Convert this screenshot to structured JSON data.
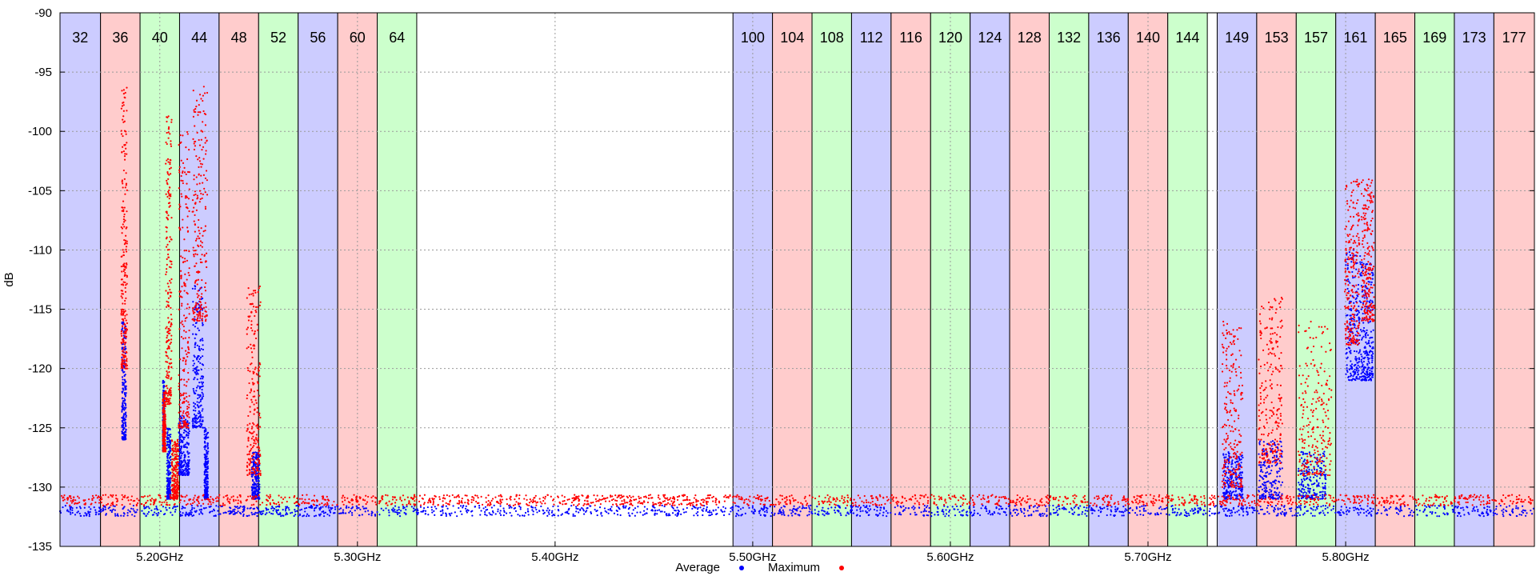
{
  "chart_data": {
    "type": "scatter",
    "xlabel": "",
    "ylabel": "dB",
    "xlim": [
      5.1495,
      5.8955
    ],
    "ylim": [
      -135,
      -90
    ],
    "grid": true,
    "x_ticks": [
      {
        "value": 5.2,
        "label": "5.20GHz"
      },
      {
        "value": 5.3,
        "label": "5.30GHz"
      },
      {
        "value": 5.4,
        "label": "5.40GHz"
      },
      {
        "value": 5.5,
        "label": "5.50GHz"
      },
      {
        "value": 5.6,
        "label": "5.60GHz"
      },
      {
        "value": 5.7,
        "label": "5.70GHz"
      },
      {
        "value": 5.8,
        "label": "5.80GHz"
      }
    ],
    "y_ticks": [
      {
        "value": -90,
        "label": "-90"
      },
      {
        "value": -95,
        "label": "-95"
      },
      {
        "value": -100,
        "label": "-100"
      },
      {
        "value": -105,
        "label": "-105"
      },
      {
        "value": -110,
        "label": "-110"
      },
      {
        "value": -115,
        "label": "-115"
      },
      {
        "value": -120,
        "label": "-120"
      },
      {
        "value": -125,
        "label": "-125"
      },
      {
        "value": -130,
        "label": "-130"
      },
      {
        "value": -135,
        "label": "-135"
      }
    ],
    "channel_colors": {
      "blue": "#ccccff",
      "red": "#ffcccc",
      "green": "#ccffcc"
    },
    "channels": [
      {
        "label": "32",
        "start": 5.1495,
        "end": 5.17,
        "color": "blue"
      },
      {
        "label": "36",
        "start": 5.17,
        "end": 5.19,
        "color": "red"
      },
      {
        "label": "40",
        "start": 5.19,
        "end": 5.21,
        "color": "green"
      },
      {
        "label": "44",
        "start": 5.21,
        "end": 5.23,
        "color": "blue"
      },
      {
        "label": "48",
        "start": 5.23,
        "end": 5.25,
        "color": "red"
      },
      {
        "label": "52",
        "start": 5.25,
        "end": 5.27,
        "color": "green"
      },
      {
        "label": "56",
        "start": 5.27,
        "end": 5.29,
        "color": "blue"
      },
      {
        "label": "60",
        "start": 5.29,
        "end": 5.31,
        "color": "red"
      },
      {
        "label": "64",
        "start": 5.31,
        "end": 5.33,
        "color": "green"
      },
      {
        "label": "100",
        "start": 5.49,
        "end": 5.51,
        "color": "blue"
      },
      {
        "label": "104",
        "start": 5.51,
        "end": 5.53,
        "color": "red"
      },
      {
        "label": "108",
        "start": 5.53,
        "end": 5.55,
        "color": "green"
      },
      {
        "label": "112",
        "start": 5.55,
        "end": 5.57,
        "color": "blue"
      },
      {
        "label": "116",
        "start": 5.57,
        "end": 5.59,
        "color": "red"
      },
      {
        "label": "120",
        "start": 5.59,
        "end": 5.61,
        "color": "green"
      },
      {
        "label": "124",
        "start": 5.61,
        "end": 5.63,
        "color": "blue"
      },
      {
        "label": "128",
        "start": 5.63,
        "end": 5.65,
        "color": "red"
      },
      {
        "label": "132",
        "start": 5.65,
        "end": 5.67,
        "color": "green"
      },
      {
        "label": "136",
        "start": 5.67,
        "end": 5.69,
        "color": "blue"
      },
      {
        "label": "140",
        "start": 5.69,
        "end": 5.71,
        "color": "red"
      },
      {
        "label": "144",
        "start": 5.71,
        "end": 5.73,
        "color": "green"
      },
      {
        "label": "149",
        "start": 5.735,
        "end": 5.755,
        "color": "blue"
      },
      {
        "label": "153",
        "start": 5.755,
        "end": 5.775,
        "color": "red"
      },
      {
        "label": "157",
        "start": 5.775,
        "end": 5.795,
        "color": "green"
      },
      {
        "label": "161",
        "start": 5.795,
        "end": 5.815,
        "color": "blue"
      },
      {
        "label": "165",
        "start": 5.815,
        "end": 5.835,
        "color": "red"
      },
      {
        "label": "169",
        "start": 5.835,
        "end": 5.855,
        "color": "green"
      },
      {
        "label": "173",
        "start": 5.855,
        "end": 5.875,
        "color": "blue"
      },
      {
        "label": "177",
        "start": 5.875,
        "end": 5.8955,
        "color": "red"
      }
    ],
    "series": [
      {
        "name": "Average",
        "color": "#0000ff",
        "floor_y": -132.0,
        "peaks": [
          {
            "x": [
              5.1808,
              5.183
            ],
            "y": [
              -126,
              -116
            ]
          },
          {
            "x": [
              5.2015,
              5.2025
            ],
            "y": [
              -127,
              -121
            ]
          },
          {
            "x": [
              5.2035,
              5.2055
            ],
            "y": [
              -131,
              -125
            ]
          },
          {
            "x": [
              5.2095,
              5.215
            ],
            "y": [
              -129,
              -124
            ]
          },
          {
            "x": [
              5.2165,
              5.222
            ],
            "y": [
              -125,
              -113
            ]
          },
          {
            "x": [
              5.2225,
              5.2245
            ],
            "y": [
              -131,
              -125
            ]
          },
          {
            "x": [
              5.2465,
              5.2505
            ],
            "y": [
              -131,
              -127
            ]
          },
          {
            "x": [
              5.738,
              5.748
            ],
            "y": [
              -131,
              -127
            ]
          },
          {
            "x": [
              5.756,
              5.768
            ],
            "y": [
              -131,
              -126
            ]
          },
          {
            "x": [
              5.776,
              5.79
            ],
            "y": [
              -131,
              -127
            ]
          },
          {
            "x": [
              5.8,
              5.808
            ],
            "y": [
              -121,
              -110
            ]
          },
          {
            "x": [
              5.808,
              5.814
            ],
            "y": [
              -121,
              -111
            ]
          }
        ]
      },
      {
        "name": "Maximum",
        "color": "#ff0000",
        "floor_y": -131.1,
        "peaks": [
          {
            "x": [
              5.1805,
              5.1835
            ],
            "y": [
              -120,
              -96
            ]
          },
          {
            "x": [
              5.2015,
              5.203
            ],
            "y": [
              -127,
              -122
            ]
          },
          {
            "x": [
              5.203,
              5.206
            ],
            "y": [
              -123,
              -98
            ]
          },
          {
            "x": [
              5.206,
              5.2095
            ],
            "y": [
              -131,
              -126
            ]
          },
          {
            "x": [
              5.2095,
              5.215
            ],
            "y": [
              -125,
              -100
            ]
          },
          {
            "x": [
              5.2165,
              5.224
            ],
            "y": [
              -116,
              -96
            ]
          },
          {
            "x": [
              5.244,
              5.251
            ],
            "y": [
              -129,
              -113
            ]
          },
          {
            "x": [
              5.7375,
              5.748
            ],
            "y": [
              -130,
              -116
            ]
          },
          {
            "x": [
              5.756,
              5.768
            ],
            "y": [
              -128,
              -114
            ]
          },
          {
            "x": [
              5.776,
              5.793
            ],
            "y": [
              -129,
              -116
            ]
          },
          {
            "x": [
              5.7995,
              5.807
            ],
            "y": [
              -118,
              -104
            ]
          },
          {
            "x": [
              5.808,
              5.8145
            ],
            "y": [
              -116,
              -104
            ]
          }
        ]
      }
    ],
    "legend": {
      "placement": "bottom-center",
      "items": [
        "Average",
        "Maximum"
      ]
    }
  }
}
